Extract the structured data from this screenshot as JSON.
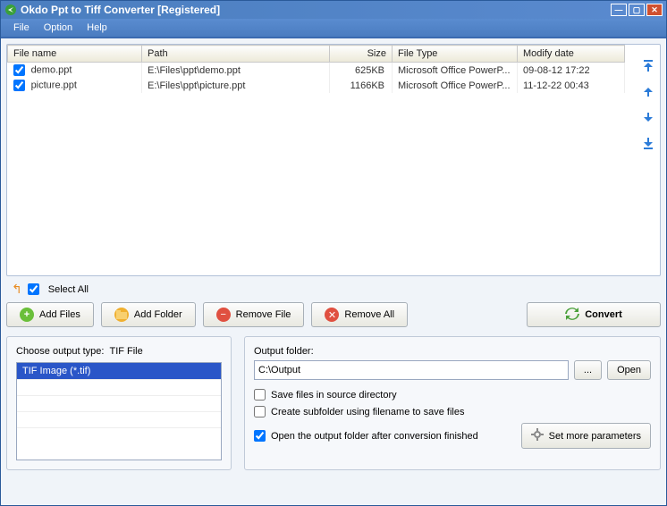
{
  "app": {
    "title": "Okdo Ppt to Tiff Converter [Registered]"
  },
  "menu": {
    "file": "File",
    "option": "Option",
    "help": "Help"
  },
  "cols": {
    "filename": "File name",
    "path": "Path",
    "size": "Size",
    "filetype": "File Type",
    "modify": "Modify date"
  },
  "files": [
    {
      "name": "demo.ppt",
      "path": "E:\\Files\\ppt\\demo.ppt",
      "size": "625KB",
      "type": "Microsoft Office PowerP...",
      "date": "09-08-12 17:22",
      "checked": true
    },
    {
      "name": "picture.ppt",
      "path": "E:\\Files\\ppt\\picture.ppt",
      "size": "1166KB",
      "type": "Microsoft Office PowerP...",
      "date": "11-12-22 00:43",
      "checked": true
    }
  ],
  "selectAll": {
    "label": "Select All",
    "checked": true
  },
  "buttons": {
    "addFiles": "Add Files",
    "addFolder": "Add Folder",
    "removeFile": "Remove File",
    "removeAll": "Remove All",
    "convert": "Convert",
    "browse": "...",
    "open": "Open",
    "more": "Set more parameters"
  },
  "outputType": {
    "label": "Choose output type:",
    "current": "TIF File",
    "option": "TIF Image (*.tif)"
  },
  "outputFolder": {
    "label": "Output folder:",
    "value": "C:\\Output"
  },
  "opts": {
    "saveSource": {
      "label": "Save files in source directory",
      "checked": false
    },
    "subfolder": {
      "label": "Create subfolder using filename to save files",
      "checked": false
    },
    "openAfter": {
      "label": "Open the output folder after conversion finished",
      "checked": true
    }
  }
}
